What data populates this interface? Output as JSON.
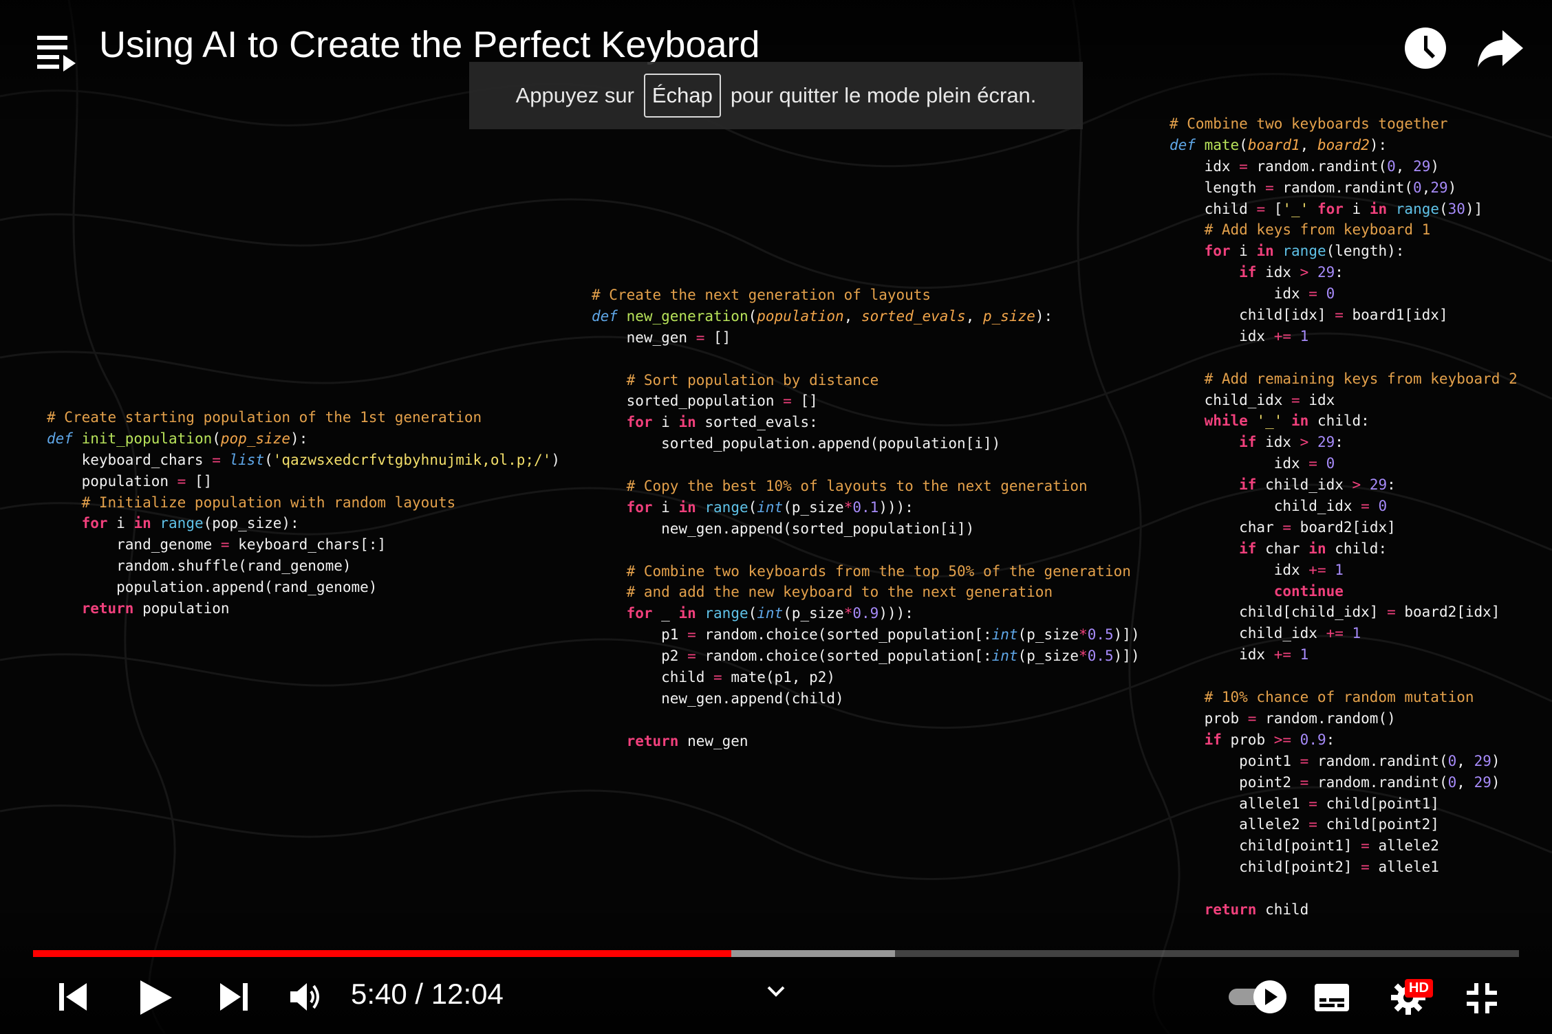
{
  "player": {
    "title": "Using AI to Create the Perfect Keyboard",
    "fullscreen_notice": {
      "before": "Appuyez sur",
      "key": "Échap",
      "after": "pour quitter le mode plein écran."
    },
    "icons": {
      "playlist": "playlist-icon",
      "watch_later": "clock-icon",
      "share": "share-arrow-icon",
      "previous": "skip-previous-icon",
      "play": "play-icon",
      "next": "skip-next-icon",
      "volume": "volume-icon",
      "chapters": "chevron-down-icon",
      "autoplay": "autoplay-toggle-icon",
      "subtitles": "subtitles-icon",
      "settings": "gear-icon",
      "exit_fullscreen": "exit-fullscreen-icon"
    },
    "time": {
      "current": "5:40",
      "separator": "/",
      "duration": "12:04",
      "display": "5:40 / 12:04"
    },
    "progress": {
      "played_fraction": 0.47,
      "buffered_fraction": 0.58
    },
    "quality_badge": "HD",
    "colors": {
      "progress_played": "#ff0000",
      "badge": "#ff0000"
    }
  },
  "code_panels": [
    {
      "id": "init",
      "lines": [
        [
          [
            "c-comment",
            "# Create starting population of the 1st generation"
          ]
        ],
        [
          [
            "c-def",
            "def "
          ],
          [
            "c-fn",
            "init_population"
          ],
          [
            "c-pl",
            "("
          ],
          [
            "c-param",
            "pop_size"
          ],
          [
            "c-pl",
            "):"
          ]
        ],
        [
          [
            "c-pl",
            "    keyboard_chars "
          ],
          [
            "c-op",
            "= "
          ],
          [
            "c-def",
            "list"
          ],
          [
            "c-pl",
            "("
          ],
          [
            "c-str",
            "'qazwsxedcrfvtgbyhnujmik,ol.p;/'"
          ],
          [
            "c-pl",
            ")"
          ]
        ],
        [
          [
            "c-pl",
            "    population "
          ],
          [
            "c-op",
            "= "
          ],
          [
            "c-pl",
            "[]"
          ]
        ],
        [
          [
            "c-comment",
            "    # Initialize population with random layouts"
          ]
        ],
        [
          [
            "c-kw",
            "    for "
          ],
          [
            "c-pl",
            "i "
          ],
          [
            "c-kw",
            "in "
          ],
          [
            "c-builtin",
            "range"
          ],
          [
            "c-pl",
            "(pop_size):"
          ]
        ],
        [
          [
            "c-pl",
            "        rand_genome "
          ],
          [
            "c-op",
            "= "
          ],
          [
            "c-pl",
            "keyboard_chars[:]"
          ]
        ],
        [
          [
            "c-pl",
            "        random.shuffle(rand_genome)"
          ]
        ],
        [
          [
            "c-pl",
            "        population.append(rand_genome)"
          ]
        ],
        [
          [
            "c-kw",
            "    return "
          ],
          [
            "c-pl",
            "population"
          ]
        ]
      ]
    },
    {
      "id": "newgen",
      "lines": [
        [
          [
            "c-comment",
            "# Create the next generation of layouts"
          ]
        ],
        [
          [
            "c-def",
            "def "
          ],
          [
            "c-fn",
            "new_generation"
          ],
          [
            "c-pl",
            "("
          ],
          [
            "c-param",
            "population"
          ],
          [
            "c-pl",
            ", "
          ],
          [
            "c-param",
            "sorted_evals"
          ],
          [
            "c-pl",
            ", "
          ],
          [
            "c-param",
            "p_size"
          ],
          [
            "c-pl",
            "):"
          ]
        ],
        [
          [
            "c-pl",
            "    new_gen "
          ],
          [
            "c-op",
            "= "
          ],
          [
            "c-pl",
            "[]"
          ]
        ],
        [
          [
            "c-pl",
            ""
          ]
        ],
        [
          [
            "c-comment",
            "    # Sort population by distance"
          ]
        ],
        [
          [
            "c-pl",
            "    sorted_population "
          ],
          [
            "c-op",
            "= "
          ],
          [
            "c-pl",
            "[]"
          ]
        ],
        [
          [
            "c-kw",
            "    for "
          ],
          [
            "c-pl",
            "i "
          ],
          [
            "c-kw",
            "in "
          ],
          [
            "c-pl",
            "sorted_evals:"
          ]
        ],
        [
          [
            "c-pl",
            "        sorted_population.append(population[i])"
          ]
        ],
        [
          [
            "c-pl",
            ""
          ]
        ],
        [
          [
            "c-comment",
            "    # Copy the best 10% of layouts to the next generation"
          ]
        ],
        [
          [
            "c-kw",
            "    for "
          ],
          [
            "c-pl",
            "i "
          ],
          [
            "c-kw",
            "in "
          ],
          [
            "c-builtin",
            "range"
          ],
          [
            "c-pl",
            "("
          ],
          [
            "c-def",
            "int"
          ],
          [
            "c-pl",
            "(p_size"
          ],
          [
            "c-op",
            "*"
          ],
          [
            "c-num",
            "0.1"
          ],
          [
            "c-pl",
            "))):"
          ]
        ],
        [
          [
            "c-pl",
            "        new_gen.append(sorted_population[i])"
          ]
        ],
        [
          [
            "c-pl",
            ""
          ]
        ],
        [
          [
            "c-comment",
            "    # Combine two keyboards from the top 50% of the generation"
          ]
        ],
        [
          [
            "c-comment",
            "    # and add the new keyboard to the next generation"
          ]
        ],
        [
          [
            "c-kw",
            "    for "
          ],
          [
            "c-pl",
            "_ "
          ],
          [
            "c-kw",
            "in "
          ],
          [
            "c-builtin",
            "range"
          ],
          [
            "c-pl",
            "("
          ],
          [
            "c-def",
            "int"
          ],
          [
            "c-pl",
            "(p_size"
          ],
          [
            "c-op",
            "*"
          ],
          [
            "c-num",
            "0.9"
          ],
          [
            "c-pl",
            "))):"
          ]
        ],
        [
          [
            "c-pl",
            "        p1 "
          ],
          [
            "c-op",
            "= "
          ],
          [
            "c-pl",
            "random.choice(sorted_population[:"
          ],
          [
            "c-def",
            "int"
          ],
          [
            "c-pl",
            "(p_size"
          ],
          [
            "c-op",
            "*"
          ],
          [
            "c-num",
            "0.5"
          ],
          [
            "c-pl",
            ")])"
          ]
        ],
        [
          [
            "c-pl",
            "        p2 "
          ],
          [
            "c-op",
            "= "
          ],
          [
            "c-pl",
            "random.choice(sorted_population[:"
          ],
          [
            "c-def",
            "int"
          ],
          [
            "c-pl",
            "(p_size"
          ],
          [
            "c-op",
            "*"
          ],
          [
            "c-num",
            "0.5"
          ],
          [
            "c-pl",
            ")])"
          ]
        ],
        [
          [
            "c-pl",
            "        child "
          ],
          [
            "c-op",
            "= "
          ],
          [
            "c-pl",
            "mate(p1, p2)"
          ]
        ],
        [
          [
            "c-pl",
            "        new_gen.append(child)"
          ]
        ],
        [
          [
            "c-pl",
            ""
          ]
        ],
        [
          [
            "c-kw",
            "    return "
          ],
          [
            "c-pl",
            "new_gen"
          ]
        ]
      ]
    },
    {
      "id": "mate",
      "lines": [
        [
          [
            "c-comment",
            "# Combine two keyboards together"
          ]
        ],
        [
          [
            "c-def",
            "def "
          ],
          [
            "c-fn",
            "mate"
          ],
          [
            "c-pl",
            "("
          ],
          [
            "c-param",
            "board1"
          ],
          [
            "c-pl",
            ", "
          ],
          [
            "c-param",
            "board2"
          ],
          [
            "c-pl",
            "):"
          ]
        ],
        [
          [
            "c-pl",
            "    idx "
          ],
          [
            "c-op",
            "= "
          ],
          [
            "c-pl",
            "random.randint("
          ],
          [
            "c-num",
            "0"
          ],
          [
            "c-pl",
            ", "
          ],
          [
            "c-num",
            "29"
          ],
          [
            "c-pl",
            ")"
          ]
        ],
        [
          [
            "c-pl",
            "    length "
          ],
          [
            "c-op",
            "= "
          ],
          [
            "c-pl",
            "random.randint("
          ],
          [
            "c-num",
            "0"
          ],
          [
            "c-pl",
            ","
          ],
          [
            "c-num",
            "29"
          ],
          [
            "c-pl",
            ")"
          ]
        ],
        [
          [
            "c-pl",
            "    child "
          ],
          [
            "c-op",
            "= "
          ],
          [
            "c-pl",
            "["
          ],
          [
            "c-str",
            "'_'"
          ],
          [
            "c-kw",
            " for "
          ],
          [
            "c-pl",
            "i "
          ],
          [
            "c-kw",
            "in "
          ],
          [
            "c-builtin",
            "range"
          ],
          [
            "c-pl",
            "("
          ],
          [
            "c-num",
            "30"
          ],
          [
            "c-pl",
            ")]"
          ]
        ],
        [
          [
            "c-comment",
            "    # Add keys from keyboard 1"
          ]
        ],
        [
          [
            "c-kw",
            "    for "
          ],
          [
            "c-pl",
            "i "
          ],
          [
            "c-kw",
            "in "
          ],
          [
            "c-builtin",
            "range"
          ],
          [
            "c-pl",
            "(length):"
          ]
        ],
        [
          [
            "c-kw",
            "        if "
          ],
          [
            "c-pl",
            "idx "
          ],
          [
            "c-op",
            "> "
          ],
          [
            "c-num",
            "29"
          ],
          [
            "c-pl",
            ":"
          ]
        ],
        [
          [
            "c-pl",
            "            idx "
          ],
          [
            "c-op",
            "= "
          ],
          [
            "c-num",
            "0"
          ]
        ],
        [
          [
            "c-pl",
            "        child[idx] "
          ],
          [
            "c-op",
            "= "
          ],
          [
            "c-pl",
            "board1[idx]"
          ]
        ],
        [
          [
            "c-pl",
            "        idx "
          ],
          [
            "c-op",
            "+= "
          ],
          [
            "c-num",
            "1"
          ]
        ],
        [
          [
            "c-pl",
            ""
          ]
        ],
        [
          [
            "c-comment",
            "    # Add remaining keys from keyboard 2"
          ]
        ],
        [
          [
            "c-pl",
            "    child_idx "
          ],
          [
            "c-op",
            "= "
          ],
          [
            "c-pl",
            "idx"
          ]
        ],
        [
          [
            "c-kw",
            "    while "
          ],
          [
            "c-str",
            "'_' "
          ],
          [
            "c-kw",
            "in "
          ],
          [
            "c-pl",
            "child:"
          ]
        ],
        [
          [
            "c-kw",
            "        if "
          ],
          [
            "c-pl",
            "idx "
          ],
          [
            "c-op",
            "> "
          ],
          [
            "c-num",
            "29"
          ],
          [
            "c-pl",
            ":"
          ]
        ],
        [
          [
            "c-pl",
            "            idx "
          ],
          [
            "c-op",
            "= "
          ],
          [
            "c-num",
            "0"
          ]
        ],
        [
          [
            "c-kw",
            "        if "
          ],
          [
            "c-pl",
            "child_idx "
          ],
          [
            "c-op",
            "> "
          ],
          [
            "c-num",
            "29"
          ],
          [
            "c-pl",
            ":"
          ]
        ],
        [
          [
            "c-pl",
            "            child_idx "
          ],
          [
            "c-op",
            "= "
          ],
          [
            "c-num",
            "0"
          ]
        ],
        [
          [
            "c-pl",
            "        char "
          ],
          [
            "c-op",
            "= "
          ],
          [
            "c-pl",
            "board2[idx]"
          ]
        ],
        [
          [
            "c-kw",
            "        if "
          ],
          [
            "c-pl",
            "char "
          ],
          [
            "c-kw",
            "in "
          ],
          [
            "c-pl",
            "child:"
          ]
        ],
        [
          [
            "c-pl",
            "            idx "
          ],
          [
            "c-op",
            "+= "
          ],
          [
            "c-num",
            "1"
          ]
        ],
        [
          [
            "c-kw",
            "            continue"
          ]
        ],
        [
          [
            "c-pl",
            "        child[child_idx] "
          ],
          [
            "c-op",
            "= "
          ],
          [
            "c-pl",
            "board2[idx]"
          ]
        ],
        [
          [
            "c-pl",
            "        child_idx "
          ],
          [
            "c-op",
            "+= "
          ],
          [
            "c-num",
            "1"
          ]
        ],
        [
          [
            "c-pl",
            "        idx "
          ],
          [
            "c-op",
            "+= "
          ],
          [
            "c-num",
            "1"
          ]
        ],
        [
          [
            "c-pl",
            ""
          ]
        ],
        [
          [
            "c-comment",
            "    # 10% chance of random mutation"
          ]
        ],
        [
          [
            "c-pl",
            "    prob "
          ],
          [
            "c-op",
            "= "
          ],
          [
            "c-pl",
            "random.random()"
          ]
        ],
        [
          [
            "c-kw",
            "    if "
          ],
          [
            "c-pl",
            "prob "
          ],
          [
            "c-op",
            ">= "
          ],
          [
            "c-num",
            "0.9"
          ],
          [
            "c-pl",
            ":"
          ]
        ],
        [
          [
            "c-pl",
            "        point1 "
          ],
          [
            "c-op",
            "= "
          ],
          [
            "c-pl",
            "random.randint("
          ],
          [
            "c-num",
            "0"
          ],
          [
            "c-pl",
            ", "
          ],
          [
            "c-num",
            "29"
          ],
          [
            "c-pl",
            ")"
          ]
        ],
        [
          [
            "c-pl",
            "        point2 "
          ],
          [
            "c-op",
            "= "
          ],
          [
            "c-pl",
            "random.randint("
          ],
          [
            "c-num",
            "0"
          ],
          [
            "c-pl",
            ", "
          ],
          [
            "c-num",
            "29"
          ],
          [
            "c-pl",
            ")"
          ]
        ],
        [
          [
            "c-pl",
            "        allele1 "
          ],
          [
            "c-op",
            "= "
          ],
          [
            "c-pl",
            "child[point1]"
          ]
        ],
        [
          [
            "c-pl",
            "        allele2 "
          ],
          [
            "c-op",
            "= "
          ],
          [
            "c-pl",
            "child[point2]"
          ]
        ],
        [
          [
            "c-pl",
            "        child[point1] "
          ],
          [
            "c-op",
            "= "
          ],
          [
            "c-pl",
            "allele2"
          ]
        ],
        [
          [
            "c-pl",
            "        child[point2] "
          ],
          [
            "c-op",
            "= "
          ],
          [
            "c-pl",
            "allele1"
          ]
        ],
        [
          [
            "c-pl",
            ""
          ]
        ],
        [
          [
            "c-kw",
            "    return "
          ],
          [
            "c-pl",
            "child"
          ]
        ]
      ]
    }
  ]
}
